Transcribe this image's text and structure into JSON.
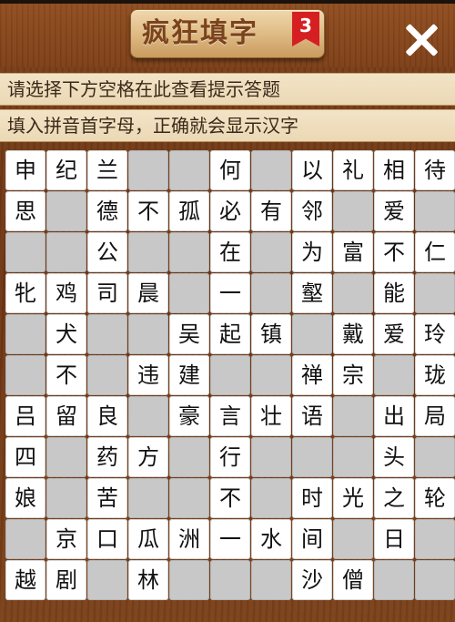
{
  "header": {
    "title": "疯狂填字",
    "level": "3"
  },
  "hints": {
    "line1": "请选择下方空格在此查看提示答题",
    "line2": "填入拼音首字母，正确就会显示汉字"
  },
  "grid": {
    "rows": [
      [
        "申",
        "纪",
        "兰",
        "",
        "",
        "何",
        "",
        "以",
        "礼",
        "相",
        "待"
      ],
      [
        "思",
        "",
        "德",
        "不",
        "孤",
        "必",
        "有",
        "邻",
        "",
        "爱",
        ""
      ],
      [
        "",
        "",
        "公",
        "",
        "",
        "在",
        "",
        "为",
        "富",
        "不",
        "仁"
      ],
      [
        "牝",
        "鸡",
        "司",
        "晨",
        "",
        "一",
        "",
        "壑",
        "",
        "能",
        ""
      ],
      [
        "",
        "犬",
        "",
        "",
        "吴",
        "起",
        "镇",
        "",
        "戴",
        "爱",
        "玲"
      ],
      [
        "",
        "不",
        "",
        "违",
        "建",
        "",
        "",
        "禅",
        "宗",
        "",
        "珑"
      ],
      [
        "吕",
        "留",
        "良",
        "",
        "豪",
        "言",
        "壮",
        "语",
        "",
        "出",
        "局"
      ],
      [
        "四",
        "",
        "药",
        "方",
        "",
        "行",
        "",
        "",
        "",
        "头",
        ""
      ],
      [
        "娘",
        "",
        "苦",
        "",
        "",
        "不",
        "",
        "时",
        "光",
        "之",
        "轮"
      ],
      [
        "",
        "京",
        "口",
        "瓜",
        "洲",
        "一",
        "水",
        "间",
        "",
        "日",
        ""
      ],
      [
        "越",
        "剧",
        "",
        "林",
        "",
        "",
        "",
        "沙",
        "僧",
        "",
        ""
      ]
    ]
  },
  "colors": {
    "wood": "#7a3f19",
    "hint_bg": "#f3e4c7",
    "cell_white": "#ffffff",
    "cell_blank": "#c8c8c8",
    "badge_red": "#d61f22"
  }
}
